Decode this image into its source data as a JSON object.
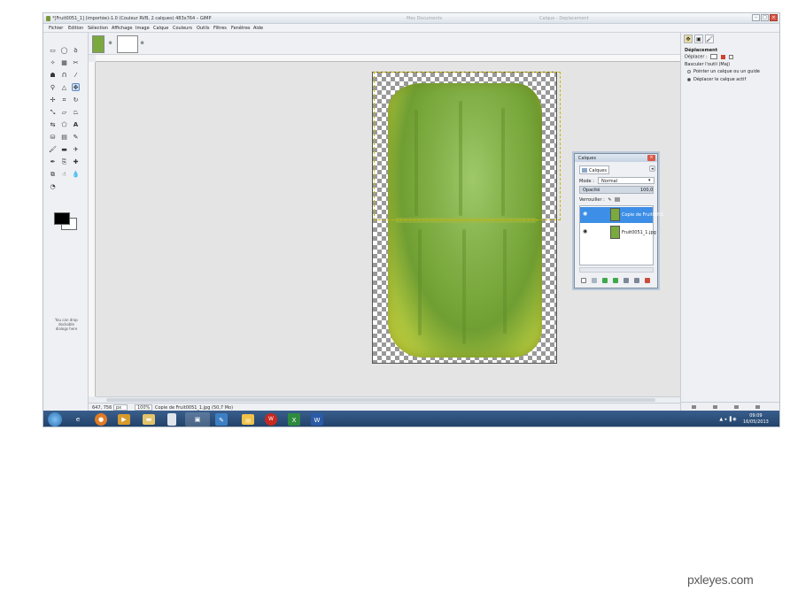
{
  "window": {
    "title": "*[Fruit0051_1] (importée)-1.0 (Couleur RVB, 2 calques) 483x764 – GIMP",
    "faded_center": "Mes Documents",
    "faded_right": "Calque - Deplacement"
  },
  "menu": {
    "items": [
      "Fichier",
      "Edition",
      "Sélection",
      "Affichage",
      "Image",
      "Calque",
      "Couleurs",
      "Outils",
      "Filtres",
      "Fenêtres",
      "Aide"
    ]
  },
  "toolbox": {
    "drop_text": "You can drop dockable dialogs here"
  },
  "statusbar": {
    "coords": "647, 756",
    "unit": "px",
    "zoom": "100%",
    "layer_info": "Copie de Fruit0051_1.jpg (50,7 Mo)"
  },
  "tool_options": {
    "title": "Déplacement",
    "move_label": "Déplacer :",
    "toggle_label": "Basculer l'outil  (Maj)",
    "option_pick": "Pointer un calque ou un guide",
    "option_active": "Déplacer le calque actif"
  },
  "layers_dialog": {
    "title": "Calques",
    "tab_label": "Calques",
    "mode_label": "Mode :",
    "mode_value": "Normal",
    "opacity_label": "Opacité",
    "opacity_value": "100,0",
    "lock_label": "Verrouiller :",
    "layers": [
      {
        "name": "Copie de Fruit0051",
        "selected": true
      },
      {
        "name": "Fruit0051_1.jpg",
        "selected": false
      }
    ]
  },
  "taskbar": {
    "time": "09:09",
    "date": "16/05/2013"
  },
  "watermark": {
    "text": "pxleyes.com"
  },
  "colors": {
    "selection": "#3d8ee6",
    "taskbar": "#1f3f66",
    "guide": "#c9b500"
  }
}
